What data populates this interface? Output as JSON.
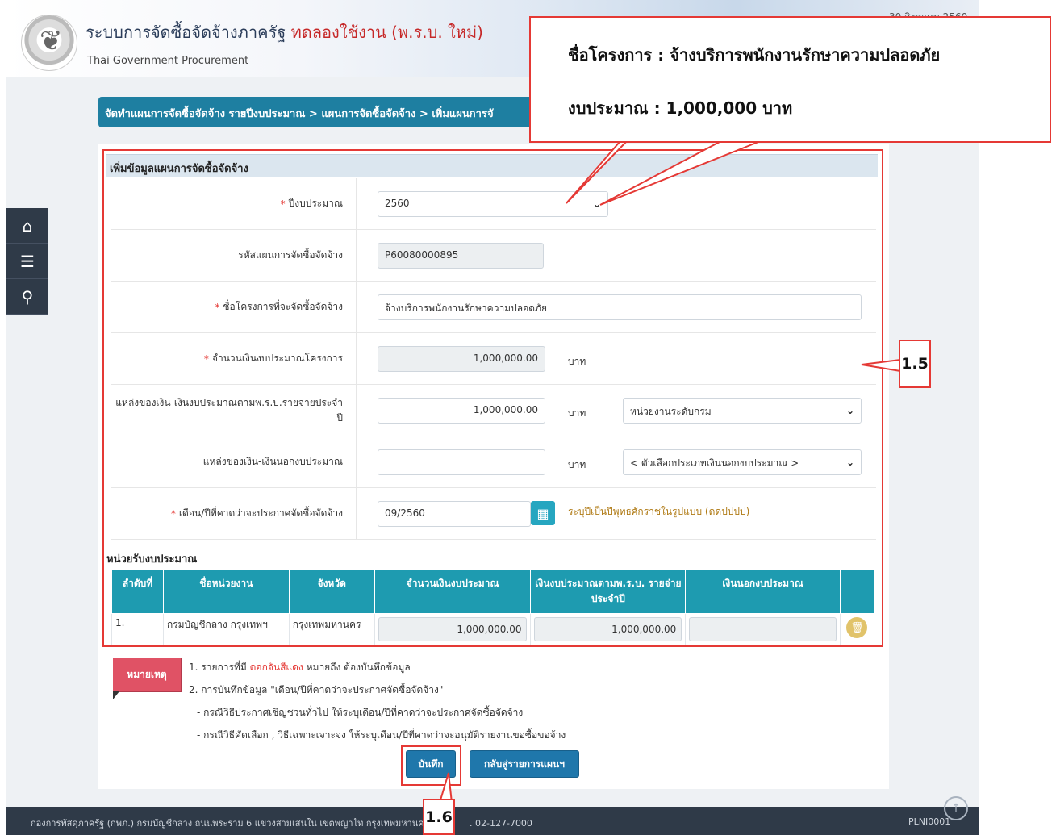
{
  "header": {
    "system_title": "ระบบการจัดซื้อจัดจ้างภาครัฐ",
    "trial_label": "ทดลองใช้งาน (พ.ร.บ. ใหม่)",
    "subtitle": "Thai Government Procurement",
    "date": "30 สิงหาคม 2560"
  },
  "sidebar": {
    "icons": [
      "home-icon",
      "menu-icon",
      "search-icon"
    ]
  },
  "breadcrumb": "จัดทำแผนการจัดซื้อจัดจ้าง รายปีงบประมาณ > แผนการจัดซื้อจัดจ้าง > เพิ่มแผนการจั",
  "form": {
    "section_title": "เพิ่มข้อมูลแผนการจัดซื้อจัดจ้าง",
    "budget_year": {
      "label": "ปีงบประมาณ",
      "value": "2560"
    },
    "plan_code": {
      "label": "รหัสแผนการจัดซื้อจัดจ้าง",
      "value": "P60080000895"
    },
    "project_name": {
      "label": "ชื่อโครงการที่จะจัดซื้อจัดจ้าง",
      "value": "จ้างบริการพนักงานรักษาความปลอดภัย"
    },
    "project_budget": {
      "label": "จำนวนเงินงบประมาณโครงการ",
      "value": "1,000,000.00",
      "unit": "บาท"
    },
    "source_annual": {
      "label": "แหล่งของเงิน-เงินงบประมาณตามพ.ร.บ.รายจ่ายประจำปี",
      "value": "1,000,000.00",
      "unit": "บาท",
      "select": "หน่วยงานระดับกรม"
    },
    "source_off": {
      "label": "แหล่งของเงิน-เงินนอกงบประมาณ",
      "value": "",
      "unit": "บาท",
      "select": "< ตัวเลือกประเภทเงินนอกงบประมาณ >"
    },
    "announce_month": {
      "label": "เดือน/ปีที่คาดว่าจะประกาศจัดซื้อจัดจ้าง",
      "value": "09/2560",
      "hint": "ระบุปีเป็นปีพุทธศักราชในรูปแบบ (ดดปปปป)"
    }
  },
  "units": {
    "title": "หน่วยรับงบประมาณ",
    "headers": [
      "ลำดับที่",
      "ชื่อหน่วยงาน",
      "จังหวัด",
      "จำนวนเงินงบประมาณ",
      "เงินงบประมาณตามพ.ร.บ. รายจ่ายประจำปี",
      "เงินนอกงบประมาณ"
    ],
    "rows": [
      {
        "no": "1.",
        "name": "กรมบัญชีกลาง กรุงเทพฯ",
        "province": "กรุงเทพมหานคร",
        "budget": "1,000,000.00",
        "annual": "1,000,000.00",
        "off": ""
      }
    ]
  },
  "notes": {
    "tag": "หมายเหตุ",
    "line1_pre": "1. รายการที่มี",
    "line1_red": "ดอกจันสีแดง",
    "line1_post": "หมายถึง ต้องบันทึกข้อมูล",
    "line2": "2. การบันทึกข้อมูล \"เดือน/ปีที่คาดว่าจะประกาศจัดซื้อจัดจ้าง\"",
    "line3": "- กรณีวิธีประกาศเชิญชวนทั่วไป ให้ระบุเดือน/ปีที่คาดว่าจะประกาศจัดซื้อจัดจ้าง",
    "line4": "- กรณีวิธีคัดเลือก , วิธีเฉพาะเจาะจง ให้ระบุเดือน/ปีที่คาดว่าจะอนุมัติรายงานขอซื้อขอจ้าง"
  },
  "buttons": {
    "save": "บันทึก",
    "back": "กลับสู่รายการแผนฯ"
  },
  "footer": {
    "address_pre": "กองการพัสดุภาครัฐ (กพภ.) กรมบัญชีกลาง ถนนพระราม 6 แขวงสามเสนใน เขตพญาไท กรุงเทพมหานคร 1",
    "address_post": ". 02-127-7000",
    "code": "PLNI0001"
  },
  "annotations": {
    "callout_line1": "ชื่อโครงการ : จ้างบริการพนักงานรักษาความปลอดภัย",
    "callout_line2": "งบประมาณ : 1,000,000 บาท",
    "label_form": "1.5",
    "label_save": "1.6"
  },
  "colors": {
    "accent": "#1e7fa1",
    "table_header": "#1e9bb0",
    "annotation": "#e53935",
    "footer": "#2f3a48"
  }
}
